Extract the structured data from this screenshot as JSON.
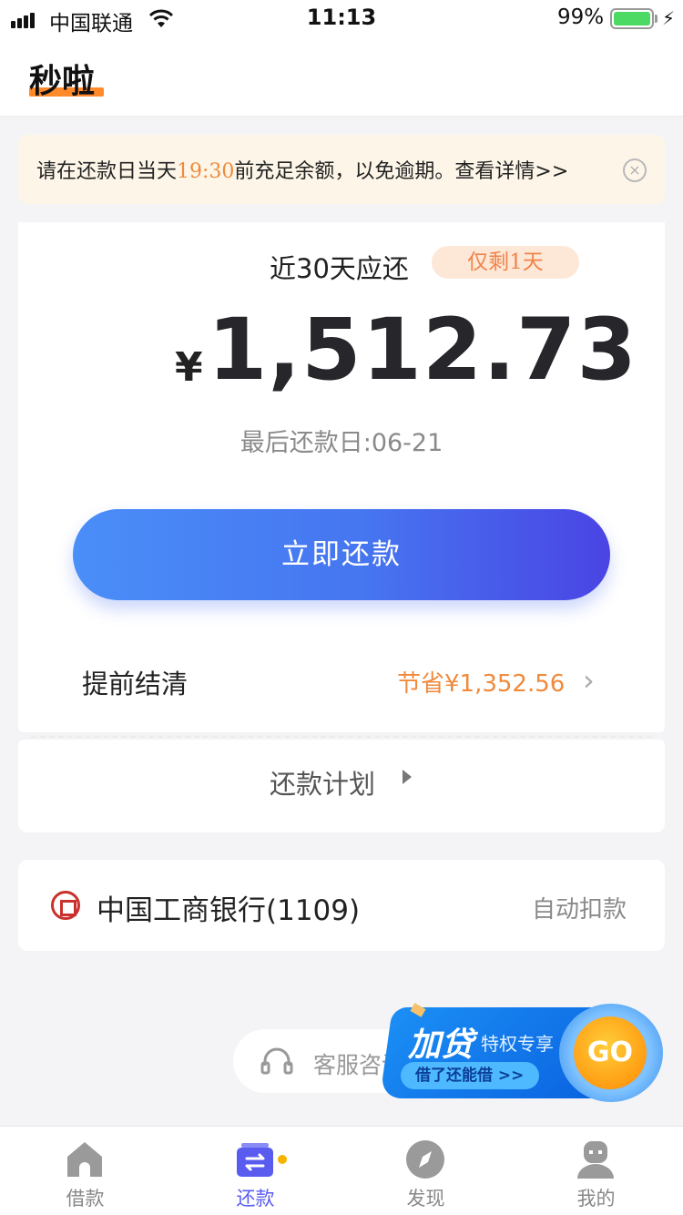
{
  "status_bar": {
    "carrier": "中国联通",
    "time": "11:13",
    "battery_pct": "99%"
  },
  "header": {
    "title": "秒啦"
  },
  "notice": {
    "text_before": "请在还款日当天",
    "highlight_time": "19:30",
    "text_after": "前充足余额，以免逾期。查看详情>>",
    "close_icon": "×"
  },
  "repayment": {
    "label": "近30天应还",
    "remaining_badge": "仅剩1天",
    "currency": "¥",
    "amount": "1,512.73",
    "last_date": "最后还款日:06-21",
    "pay_button": "立即还款",
    "early_label": "提前结清",
    "early_saving": "节省¥1,352.56",
    "chevron": "›"
  },
  "plan": {
    "label": "还款计划"
  },
  "bank": {
    "name": "中国工商银行(1109)",
    "mode": "自动扣款"
  },
  "customer_service": {
    "label": "客服咨询"
  },
  "promo": {
    "main": "加贷",
    "sub": "特权专享",
    "tag": "借了还能借  >>",
    "go": "GO"
  },
  "tabs": [
    {
      "label": "借款",
      "icon": "home-icon"
    },
    {
      "label": "还款",
      "icon": "repay-icon"
    },
    {
      "label": "发现",
      "icon": "compass-icon"
    },
    {
      "label": "我的",
      "icon": "profile-icon"
    }
  ],
  "colors": {
    "accent_blue": "#4675f0",
    "accent_orange": "#f08a3c",
    "active_tab": "#5a5cf0"
  }
}
